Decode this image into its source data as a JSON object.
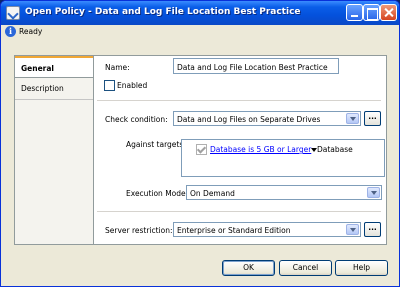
{
  "window": {
    "title": "Open Policy - Data and Log File Location Best Practice",
    "controls": {
      "minimize": "minimize",
      "maximize": "maximize",
      "close": "close"
    }
  },
  "status": {
    "icon": "info-icon",
    "text": "Ready",
    "icon_glyph": "i"
  },
  "tabs": [
    {
      "label": "General",
      "selected": true
    },
    {
      "label": "Description",
      "selected": false
    }
  ],
  "general": {
    "name_label": "Name:",
    "name_value": "Data and Log File Location Best Practice",
    "enabled_label": "Enabled",
    "enabled_checked": false,
    "check_condition_label": "Check condition:",
    "check_condition_value": "Data and Log Files on Separate Drives",
    "against_targets_label": "Against targets:",
    "target": {
      "checked": true,
      "condition": "Database is 5 GB or Larger",
      "type": "Database"
    },
    "execution_mode_label": "Execution Mode:",
    "execution_mode_value": "On Demand",
    "server_restriction_label": "Server restriction:",
    "server_restriction_value": "Enterprise or Standard Edition",
    "ellipsis": "..."
  },
  "buttons": {
    "ok": "OK",
    "cancel": "Cancel",
    "help": "Help"
  }
}
